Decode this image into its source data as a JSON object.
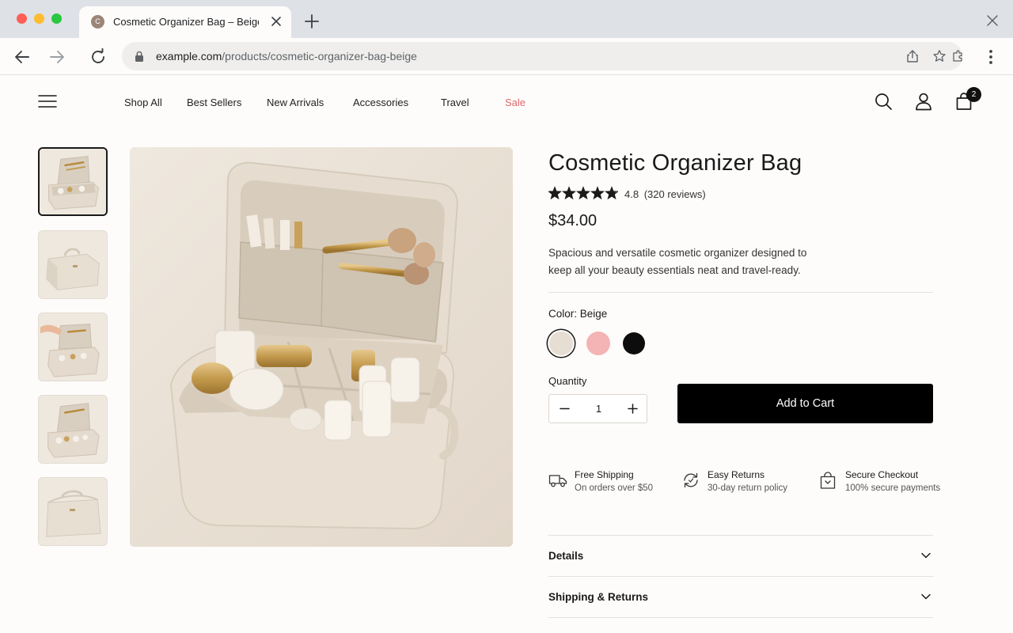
{
  "browser": {
    "tab_title": "Cosmetic Organizer Bag – Beige",
    "favicon_letter": "C",
    "url_host": "example.com",
    "url_path": "/products/cosmetic-organizer-bag-beige"
  },
  "site_nav": {
    "links": [
      "Shop All",
      "Best Sellers",
      "New Arrivals",
      "Accessories",
      "Travel",
      "Sale"
    ],
    "cart_count": "2",
    "sale_color": "#e0686a"
  },
  "gallery": {
    "thumbnail_count": 5,
    "active_index": 0
  },
  "product": {
    "title": "Cosmetic Organizer Bag",
    "rating_value": 4.8,
    "rating_text": "4.8",
    "reviews_text": "(320 reviews)",
    "price": "$34.00",
    "description": "Spacious and versatile cosmetic organizer designed to keep all your beauty essentials neat and travel-ready.",
    "color_label": "Color: Beige",
    "colors": [
      {
        "name": "Beige",
        "hex": "#e6ddd3",
        "selected": true
      },
      {
        "name": "Pink",
        "hex": "#f4b3b5",
        "selected": false
      },
      {
        "name": "Black",
        "hex": "#0d0d0d",
        "selected": false
      }
    ],
    "quantity_label": "Quantity",
    "quantity": "1",
    "add_to_cart": "Add to Cart"
  },
  "features": [
    {
      "icon": "truck-icon",
      "title": "Free Shipping",
      "subtitle": "On orders over $50"
    },
    {
      "icon": "returns-icon",
      "title": "Easy Returns",
      "subtitle": "30-day return policy"
    },
    {
      "icon": "shopping-bag-icon",
      "title": "Secure Checkout",
      "subtitle": "100% secure payments"
    }
  ],
  "accordions": [
    {
      "label": "Details"
    },
    {
      "label": "Shipping & Returns"
    }
  ]
}
